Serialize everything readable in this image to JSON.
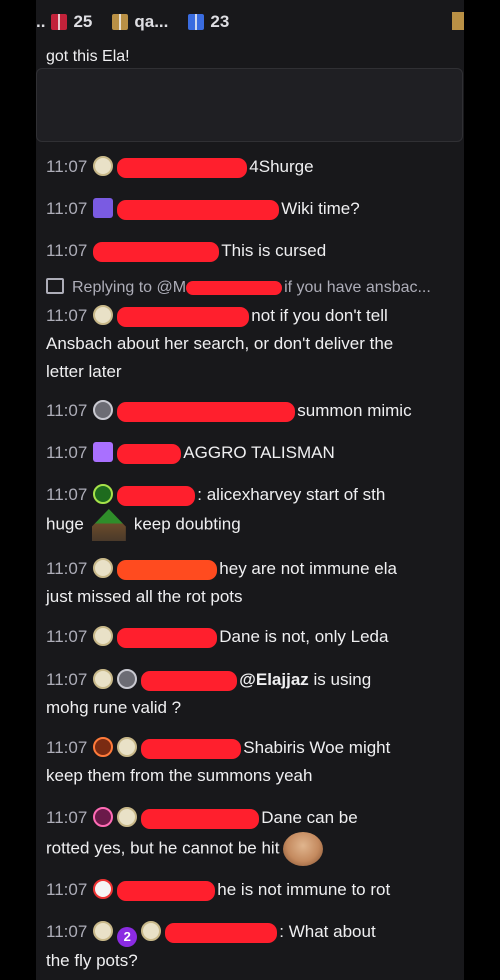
{
  "gift_bar": {
    "items": [
      {
        "prefix": "..",
        "icon": "gift-icon",
        "count": "25",
        "color": "#c2223a"
      },
      {
        "icon": "gift-icon",
        "label": "qa...",
        "color": "#b99045"
      },
      {
        "icon": "gift-icon",
        "count": "23",
        "color": "#3a6ce0"
      }
    ]
  },
  "pinned_text": "got this Ela!",
  "reply": {
    "label": "Replying to @M",
    "tail": "if you have ansbac..."
  },
  "messages": [
    {
      "time": "11:07",
      "text": "4Shurge"
    },
    {
      "time": "11:07",
      "text": "Wiki time?"
    },
    {
      "time": "11:07",
      "text": "This is cursed"
    },
    {
      "time": "11:07",
      "text": "not if you don't tell",
      "cont": "Ansbach about her search, or don't deliver the",
      "cont2": "letter later"
    },
    {
      "time": "11:07",
      "text": "summon mimic"
    },
    {
      "time": "11:07",
      "text": "AGGRO TALISMAN"
    },
    {
      "time": "11:07",
      "text": ": alicexharvey start of sth",
      "cont_a": "huge",
      "cont_b": "keep doubting"
    },
    {
      "time": "11:07",
      "text": "hey are not immune ela",
      "cont": "just missed all the rot pots"
    },
    {
      "time": "11:07",
      "text": "Dane is not, only Leda"
    },
    {
      "time": "11:07",
      "mention": "@Elajjaz",
      "text": " is using",
      "cont": "mohg rune valid ?"
    },
    {
      "time": "11:07",
      "text": "Shabiris Woe might",
      "cont": "keep them from the summons yeah"
    },
    {
      "time": "11:07",
      "text": "Dane can be",
      "cont": "rotted yes, but he cannot be hit"
    },
    {
      "time": "11:07",
      "text": "he is not immune to rot"
    },
    {
      "time": "11:07",
      "badge_number": "2",
      "text": ": What about",
      "cont": "the fly pots?"
    }
  ]
}
